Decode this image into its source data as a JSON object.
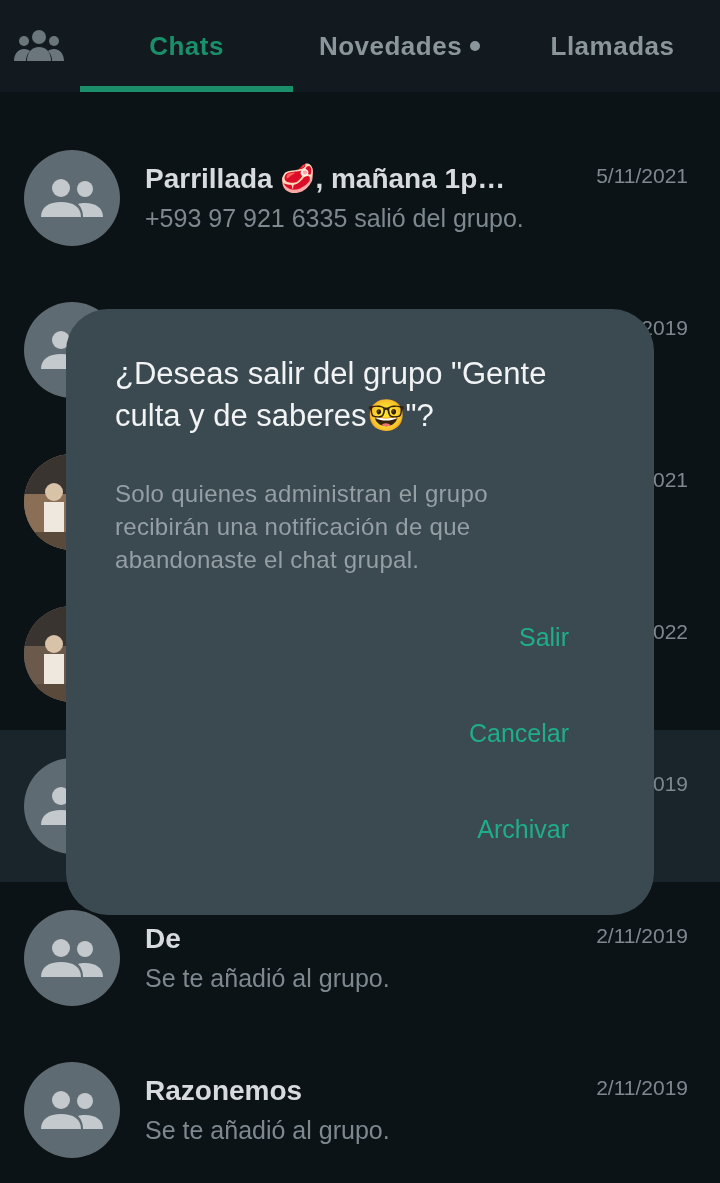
{
  "tabs": [
    {
      "label": "Chats",
      "selected": true,
      "dot": false
    },
    {
      "label": "Novedades",
      "selected": false,
      "dot": true
    },
    {
      "label": "Llamadas",
      "selected": false,
      "dot": false
    }
  ],
  "chats": [
    {
      "name": "Parrillada 🥩, mañana 1p…",
      "message": "+593 97 921 6335 salió del grupo.",
      "date": "5/11/2021",
      "kind": "group",
      "selected": false
    },
    {
      "date": "2019",
      "kind": "group",
      "selected": false
    },
    {
      "date": "021",
      "kind": "picture",
      "selected": false
    },
    {
      "date": "022",
      "kind": "picture",
      "selected": false
    },
    {
      "date": "019",
      "kind": "group",
      "selected": true
    },
    {
      "name": "De",
      "message": "Se te añadió al grupo.",
      "date": "2/11/2019",
      "kind": "group",
      "selected": false
    },
    {
      "name": "Razonemos",
      "message": "Se te añadió al grupo.",
      "date": "2/11/2019",
      "kind": "group",
      "selected": false
    }
  ],
  "dialog": {
    "title": "¿Deseas salir del grupo \"Gente culta y de saberes🤓\"?",
    "message": "Solo quienes administran el grupo recibirán una notificación de que abandonaste el chat grupal.",
    "buttons": [
      "Salir",
      "Cancelar",
      "Archivar"
    ]
  }
}
